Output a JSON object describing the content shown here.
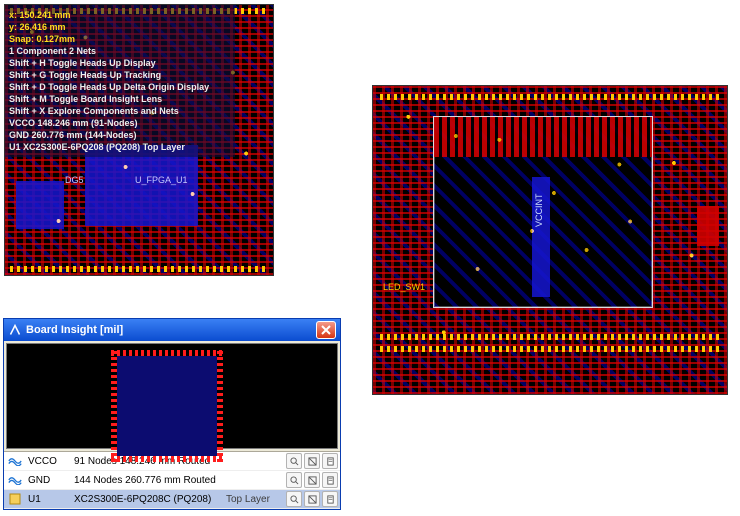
{
  "colors": {
    "trace_red": "#d00000",
    "trace_blue": "#1515d0",
    "pad": "#ffc900",
    "hud_text": "#f7f7c4"
  },
  "viewA": {
    "hud": {
      "x_label": "x: 150.241  mm",
      "y_label": "y: 26.416  mm",
      "snap": "Snap: 0.127mm",
      "comp_nets": "1 Component 2 Nets",
      "line1": "Shift + H   Toggle Heads Up Display",
      "line2": "Shift + G   Toggle Heads Up Tracking",
      "line3": "Shift + D   Toggle Heads Up Delta Origin Display",
      "line4": "Shift + M  Toggle Board Insight Lens",
      "line5": "Shift + X   Explore Components and Nets",
      "vcco": "VCCO   148.246 mm   (91-Nodes)",
      "gnd": "GND     260.776 mm   (144-Nodes)",
      "u1": "U1   XC2S300E-6PQ208 (PQ208)   Top Layer"
    },
    "label_dg5": "DG5",
    "label_fpga": "U_FPGA_U1"
  },
  "viewC": {
    "lens_label": "LED_SW1",
    "vccint": "VCCINT"
  },
  "insight": {
    "title": "Board Insight [mil]",
    "rows": [
      {
        "icon": "net",
        "name": "VCCO",
        "desc": "91 Nodes 148.246 mm Routed",
        "extra": ""
      },
      {
        "icon": "net",
        "name": "GND",
        "desc": "144 Nodes 260.776 mm Routed",
        "extra": ""
      },
      {
        "icon": "comp",
        "name": "U1",
        "desc": "XC2S300E-6PQ208C (PQ208)",
        "extra": "Top Layer"
      }
    ],
    "actions": {
      "zoom": "zoom",
      "mask": "mask",
      "sheet": "sheet"
    }
  }
}
